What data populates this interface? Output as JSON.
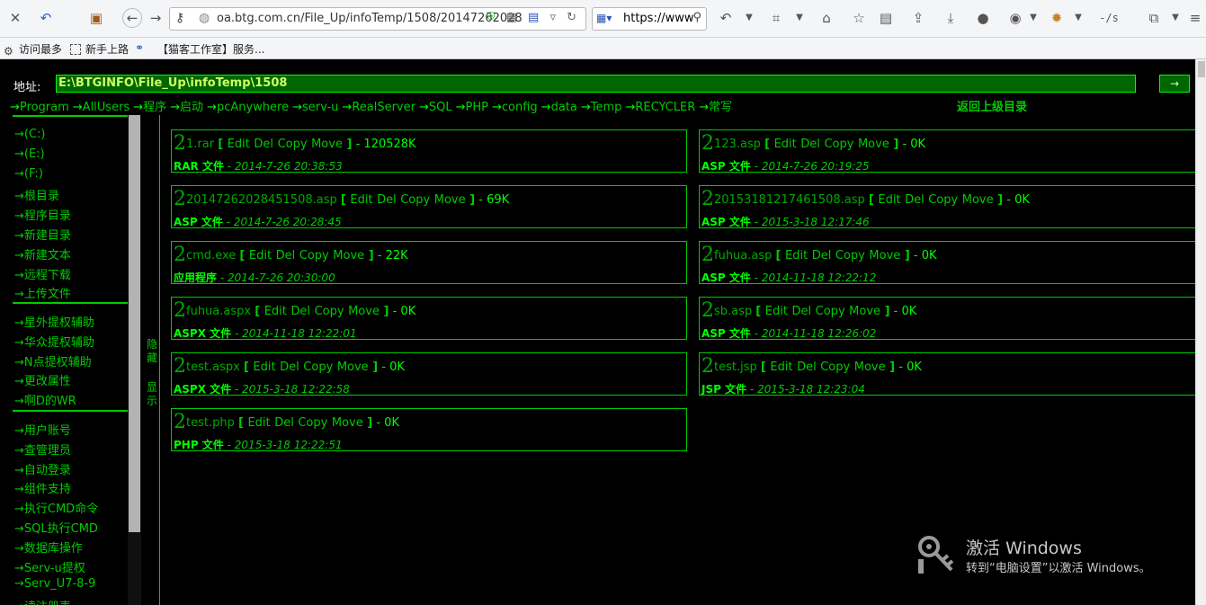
{
  "browser": {
    "url": "oa.btg.com.cn/File_Up/infoTemp/1508/20147262028",
    "search_text": "https://www",
    "toolbar_icons": [
      "close-icon",
      "refresh-icon",
      "history-icon",
      "back-icon",
      "forward-icon",
      "key-icon",
      "site-icon",
      "shield-icon",
      "qr-icon",
      "word-icon",
      "dropdown-icon",
      "reload-icon",
      "undo-icon",
      "crop-icon",
      "home-icon",
      "star-icon",
      "reader-icon",
      "share-icon",
      "download-icon",
      "person-icon",
      "globe-icon",
      "firebug-icon",
      "dev-icon",
      "cast-icon",
      "menu-icon"
    ],
    "bookmarks": [
      {
        "label": "访问最多",
        "icon": "gear-icon"
      },
      {
        "label": "新手上路",
        "icon": "page-icon"
      },
      {
        "label": "",
        "icon": "link-icon"
      },
      {
        "label": "【猫客工作室】服务...",
        "icon": "none"
      }
    ]
  },
  "address": {
    "label": "地址:",
    "value": "E:\\BTGINFO\\File_Up\\infoTemp\\1508",
    "go_label": "→"
  },
  "quicklinks": [
    "Program",
    "AllUsers",
    "程序",
    "启动",
    "pcAnywhere",
    "serv-u",
    "RealServer",
    "SQL",
    "PHP",
    "config",
    "data",
    "Temp",
    "RECYCLER",
    "常写"
  ],
  "back_link": "返回上级目录",
  "sidebar": {
    "group1": [
      "→(C:)",
      "→(E:)",
      "→(F:)",
      "→根目录",
      "→程序目录",
      "→新建目录",
      "→新建文本",
      "→远程下载",
      "→上传文件"
    ],
    "group2": [
      "→星外提权辅助",
      "→华众提权辅助",
      "→N点提权辅助",
      "→更改属性",
      "→啊D的WR"
    ],
    "group3": [
      "→用户账号",
      "→查管理员",
      "→自动登录",
      "→组件支持",
      "→执行CMD命令",
      "→SQL执行CMD",
      "→数据库操作",
      "→Serv-u提权",
      "→Serv_U7-8-9",
      "→读注册表"
    ],
    "hide_label": "隐藏",
    "show_label": "显示"
  },
  "file_ops": {
    "open": "[",
    "edit": "Edit",
    "del": "Del",
    "copy": "Copy",
    "move": "Move",
    "close": "]"
  },
  "files": [
    {
      "glyph": "2",
      "name": "1.rar",
      "size": "- 120528K",
      "type": "RAR 文件",
      "date": "- 2014-7-26 20:38:53"
    },
    {
      "glyph": "2",
      "name": "123.asp",
      "size": "- 0K",
      "type": "ASP 文件",
      "date": "- 2014-7-26 20:19:25"
    },
    {
      "glyph": "2",
      "name": "20147262028451508.asp",
      "size": "- 69K",
      "type": "ASP 文件",
      "date": "- 2014-7-26 20:28:45"
    },
    {
      "glyph": "2",
      "name": "20153181217461508.asp",
      "size": "- 0K",
      "type": "ASP 文件",
      "date": "- 2015-3-18 12:17:46"
    },
    {
      "glyph": "2",
      "name": "cmd.exe",
      "size": "- 22K",
      "type": "应用程序",
      "date": "- 2014-7-26 20:30:00"
    },
    {
      "glyph": "2",
      "name": "fuhua.asp",
      "size": "- 0K",
      "type": "ASP 文件",
      "date": "- 2014-11-18 12:22:12"
    },
    {
      "glyph": "2",
      "name": "fuhua.aspx",
      "size": "- 0K",
      "type": "ASPX 文件",
      "date": "- 2014-11-18 12:22:01"
    },
    {
      "glyph": "2",
      "name": "sb.asp",
      "size": "- 0K",
      "type": "ASP 文件",
      "date": "- 2014-11-18 12:26:02"
    },
    {
      "glyph": "2",
      "name": "test.aspx",
      "size": "- 0K",
      "type": "ASPX 文件",
      "date": "- 2015-3-18 12:22:58"
    },
    {
      "glyph": "2",
      "name": "test.jsp",
      "size": "- 0K",
      "type": "JSP 文件",
      "date": "- 2015-3-18 12:23:04"
    },
    {
      "glyph": "2",
      "name": "test.php",
      "size": "- 0K",
      "type": "PHP 文件",
      "date": "- 2015-3-18 12:22:51"
    }
  ],
  "watermark": {
    "title": "激活 Windows",
    "subtitle": "转到“电脑设置”以激活 Windows。"
  },
  "colors": {
    "accent": "#00cc00",
    "bright": "#00ff00",
    "address_bg": "#006600",
    "background": "#000000"
  }
}
